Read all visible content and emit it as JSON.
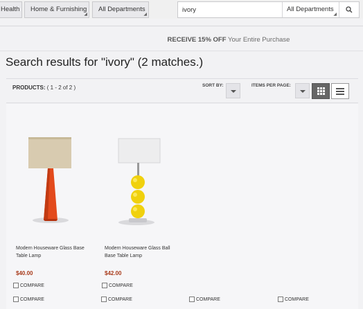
{
  "nav": {
    "tabs": [
      "Health",
      "Home & Furnishing",
      "All Departments"
    ]
  },
  "search": {
    "query": "ivory",
    "department": "All Departments"
  },
  "promo": {
    "bold": "RECEIVE 15% OFF",
    "rest": " Your Entire Purchase"
  },
  "page": {
    "title": "Search results for \"ivory\" (2 matches.)"
  },
  "toolbar": {
    "products_label": "PRODUCTS:",
    "products_range": " ( 1 - 2 of 2 )",
    "sort_by_label": "SORT BY:",
    "items_per_page_label": "ITEMS PER PAGE:"
  },
  "products": [
    {
      "name": "Modern Houseware Glass Base Table Lamp",
      "price": "$40.00",
      "compare": "COMPARE"
    },
    {
      "name": "Modern Houseware Glass Ball Base Table Lamp",
      "price": "$42.00",
      "compare": "COMPARE"
    }
  ],
  "compare_row": [
    "COMPARE",
    "COMPARE",
    "COMPARE",
    "COMPARE"
  ],
  "colors": {
    "price": "#a83a1a",
    "accent_view": "#666666"
  },
  "icons": {
    "search": "search-icon",
    "grid_view": "grid-view-icon",
    "list_view": "list-view-icon"
  }
}
